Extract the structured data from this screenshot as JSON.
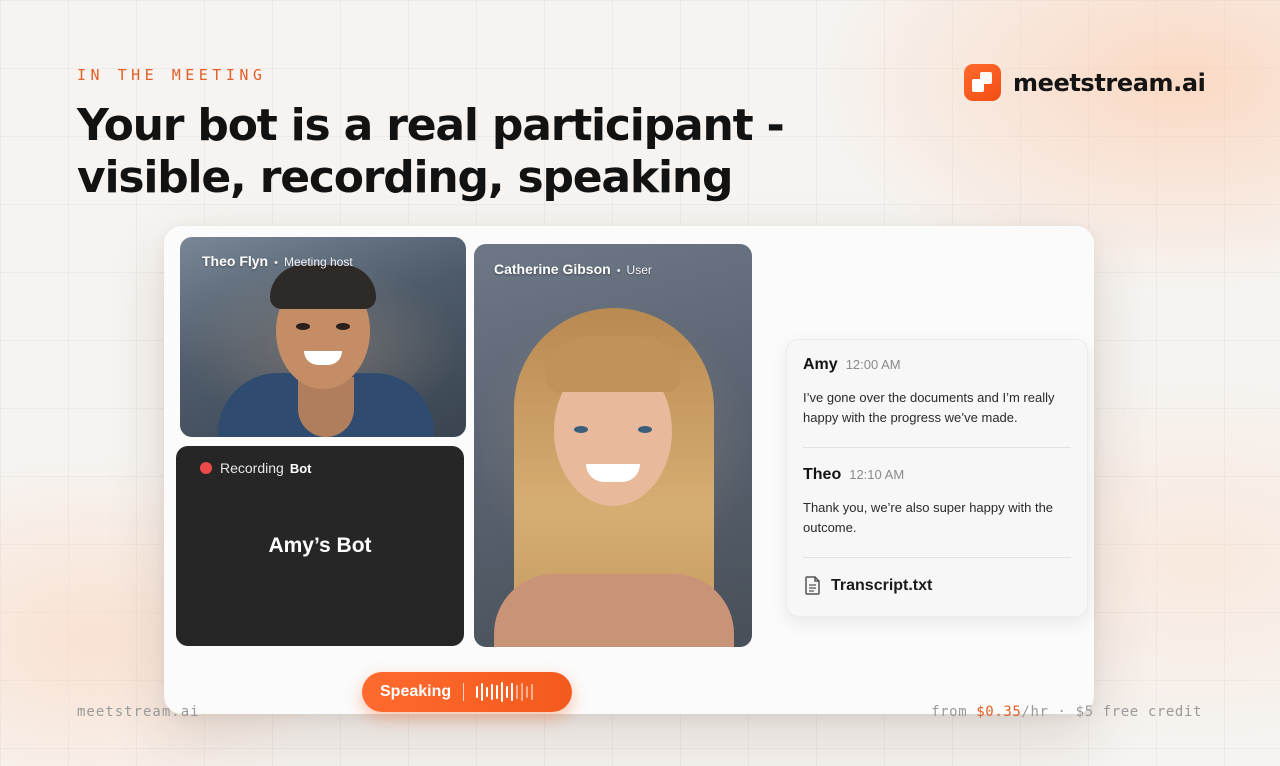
{
  "eyebrow": "IN THE MEETING",
  "headline": {
    "line1": "Your bot is a real participant -",
    "line2": "visible, recording, speaking"
  },
  "brand": {
    "name": "meetstream.ai",
    "logo_icon": "meetstream-logo-icon",
    "accent": "#f4561c"
  },
  "participants": [
    {
      "name": "Theo Flyn",
      "role": "Meeting host"
    },
    {
      "name": "Catherine Gibson",
      "role": "User"
    }
  ],
  "bot_tile": {
    "recording_label": "Recording",
    "bot_tag": "Bot",
    "name": "Amy’s Bot",
    "recording_color": "#ee4a4a"
  },
  "chat": {
    "messages": [
      {
        "author": "Amy",
        "time": "12:00 AM",
        "text": "I’ve gone over the documents and I’m really happy with the progress we’ve made."
      },
      {
        "author": "Theo",
        "time": "12:10 AM",
        "text": "Thank you, we’re also super happy with the outcome."
      }
    ],
    "attachment": {
      "icon": "file-icon",
      "name": "Transcript.txt"
    }
  },
  "speaking": {
    "label": "Speaking",
    "icon": "audio-waveform-icon"
  },
  "footer": {
    "left": "meetstream.ai",
    "right_prefix": "from ",
    "price": "$0.35",
    "right_suffix": "/hr · $5 free credit"
  }
}
